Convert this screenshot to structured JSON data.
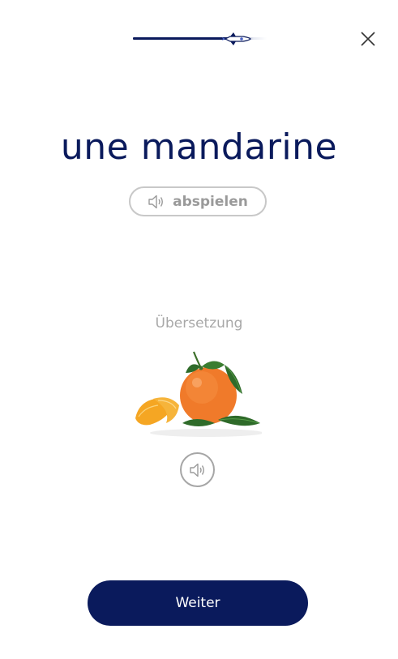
{
  "progress": {
    "value": 0.72
  },
  "word": {
    "text": "une mandarine"
  },
  "play": {
    "label": "abspielen",
    "icon": "speaker-icon"
  },
  "translation": {
    "label": "Übersetzung"
  },
  "image": {
    "subject": "mandarin-orange-image"
  },
  "audio": {
    "icon": "speaker-icon"
  },
  "next": {
    "label": "Weiter"
  },
  "colors": {
    "primary": "#0a1a5c",
    "muted_border": "#c8c8c8",
    "muted_text": "#9a9a9a",
    "orange": "#f07a2a",
    "leaf": "#2f6b2a"
  }
}
